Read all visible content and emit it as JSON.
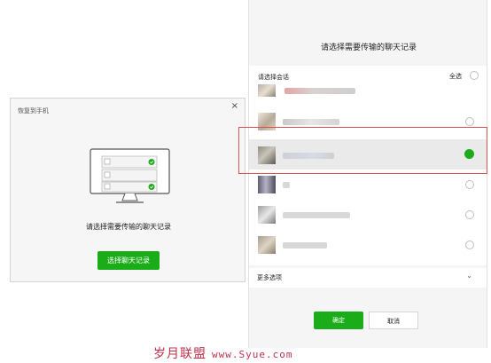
{
  "restore_dialog": {
    "title": "恢复到手机",
    "close_label": "×",
    "message": "请选择需要传输的聊天记录",
    "button_label": "选择聊天记录"
  },
  "chat_panel": {
    "title": "请选择需要传输的聊天记录",
    "list_header": "请选择会话",
    "select_all_label": "全选",
    "more_options_label": "更多选项",
    "confirm_label": "确定",
    "cancel_label": "取消",
    "rows": [
      {
        "selected": false
      },
      {
        "selected": false
      },
      {
        "selected": true
      },
      {
        "selected": false
      },
      {
        "selected": false
      },
      {
        "selected": false
      }
    ]
  },
  "colors": {
    "accent_green": "#1aad19",
    "highlight_red": "#d9534f",
    "watermark": "#c0304a"
  },
  "watermark": {
    "brand": "岁月联盟",
    "url": "www.Syue.com"
  }
}
